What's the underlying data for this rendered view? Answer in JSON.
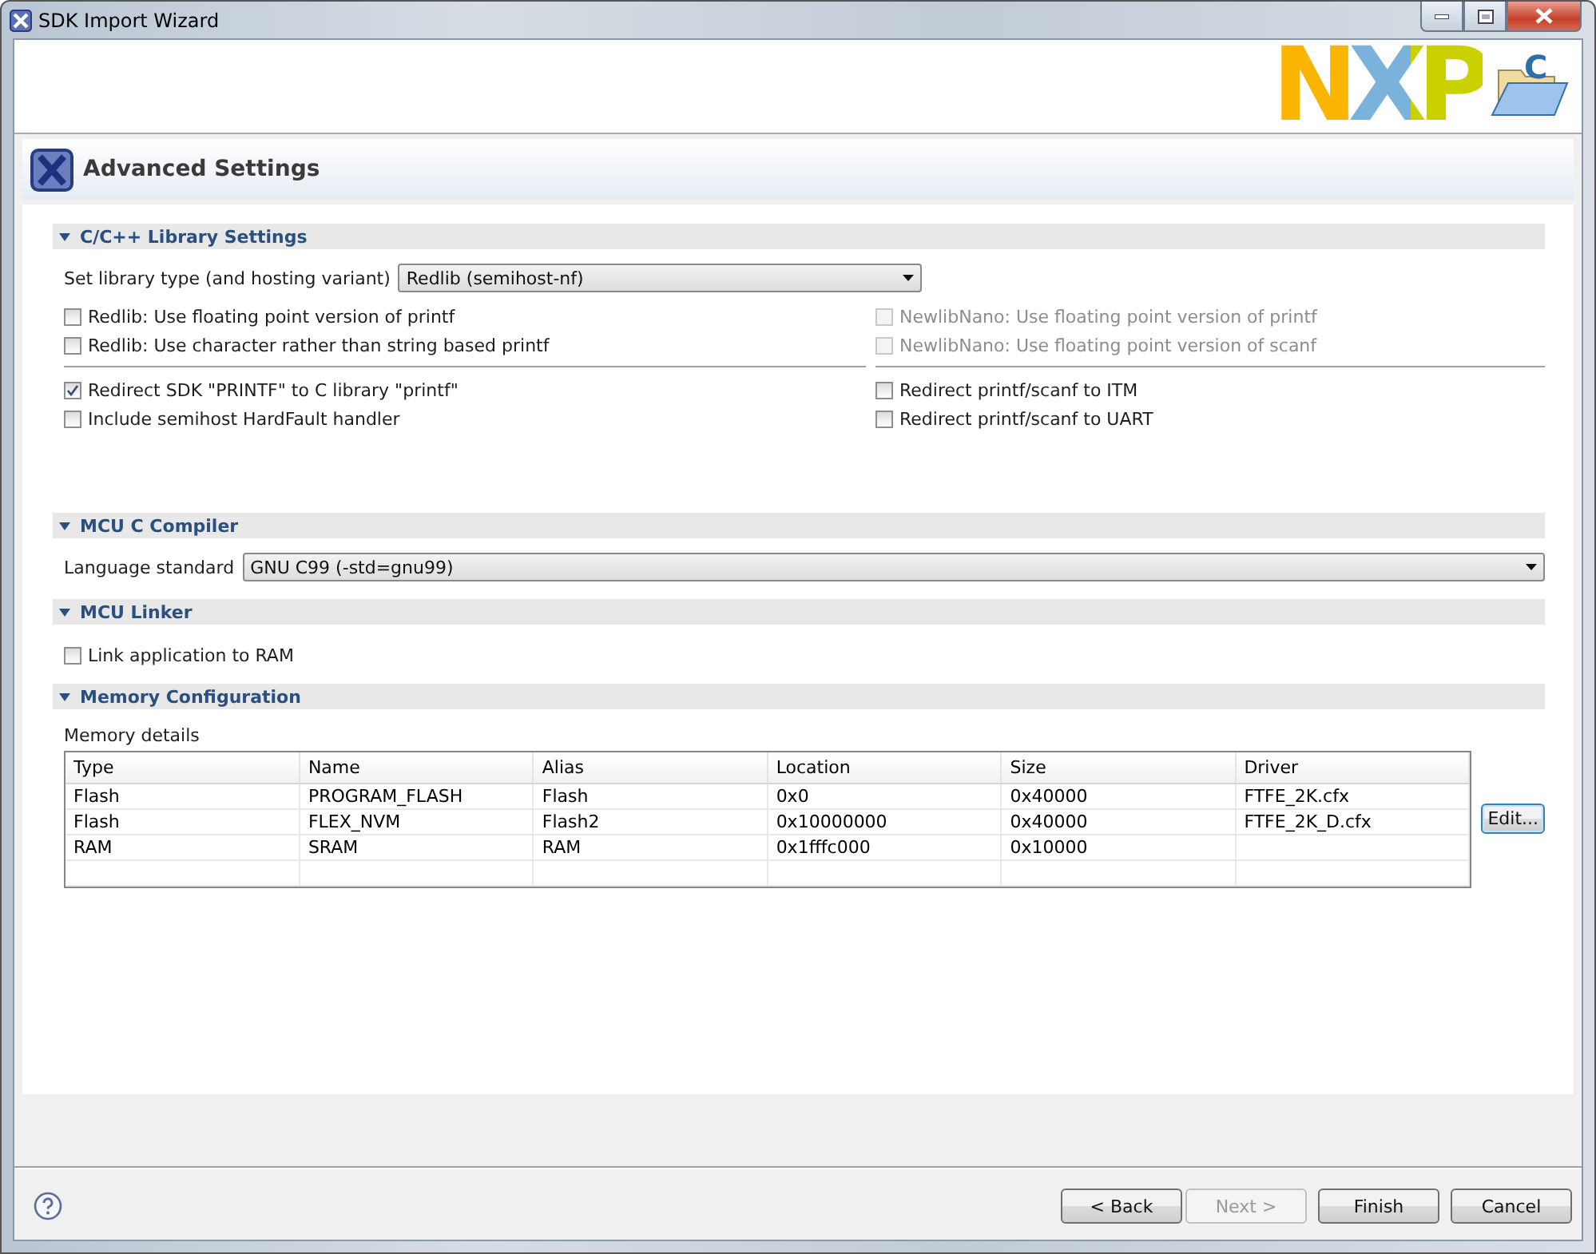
{
  "window": {
    "title": "SDK Import Wizard"
  },
  "header": {
    "logo": "NXP",
    "folder_icon_letter": "C"
  },
  "page": {
    "title": "Advanced Settings"
  },
  "sections": [
    {
      "title": "C/C++ Library Settings",
      "expanded": true,
      "items": [
        {
          "kind": "select",
          "label": "Set library type (and hosting variant)",
          "value": "Redlib (semihost-nf)",
          "wide": false
        },
        {
          "kind": "checkgrid",
          "left": [
            [
              {
                "label": "Redlib: Use floating point version of printf",
                "checked": false,
                "disabled": false
              },
              {
                "label": "Redlib: Use character rather than string based printf",
                "checked": false,
                "disabled": false
              }
            ],
            [
              {
                "label": "Redirect SDK \"PRINTF\" to C library \"printf\"",
                "checked": true,
                "disabled": false
              },
              {
                "label": "Include semihost HardFault handler",
                "checked": false,
                "disabled": false
              }
            ]
          ],
          "right": [
            [
              {
                "label": "NewlibNano: Use floating point version of printf",
                "checked": false,
                "disabled": true
              },
              {
                "label": "NewlibNano: Use floating point version of scanf",
                "checked": false,
                "disabled": true
              }
            ],
            [
              {
                "label": "Redirect printf/scanf to ITM",
                "checked": false,
                "disabled": false
              },
              {
                "label": "Redirect printf/scanf to UART",
                "checked": false,
                "disabled": false
              }
            ]
          ]
        }
      ]
    },
    {
      "title": "MCU C Compiler",
      "expanded": true,
      "items": [
        {
          "kind": "select",
          "label": "Language standard",
          "value": "GNU C99 (-std=gnu99)",
          "wide": true
        }
      ]
    },
    {
      "title": "MCU Linker",
      "expanded": true,
      "items": [
        {
          "kind": "checkbox",
          "label": "Link application to RAM",
          "checked": false,
          "disabled": false
        }
      ]
    },
    {
      "title": "Memory Configuration",
      "expanded": true,
      "items": [
        {
          "kind": "table",
          "label": "Memory details",
          "columns": [
            "Type",
            "Name",
            "Alias",
            "Location",
            "Size",
            "Driver"
          ],
          "rows": [
            [
              "Flash",
              "PROGRAM_FLASH",
              "Flash",
              "0x0",
              "0x40000",
              "FTFE_2K.cfx"
            ],
            [
              "Flash",
              "FLEX_NVM",
              "Flash2",
              "0x10000000",
              "0x40000",
              "FTFE_2K_D.cfx"
            ],
            [
              "RAM",
              "SRAM",
              "RAM",
              "0x1fffc000",
              "0x10000",
              ""
            ]
          ],
          "button": "Edit..."
        }
      ]
    }
  ],
  "footer": {
    "buttons": [
      {
        "label": "< Back",
        "disabled": false,
        "kind": "normal"
      },
      {
        "label": "Next >",
        "disabled": true,
        "kind": "normal"
      },
      {
        "label": "Finish",
        "disabled": false,
        "kind": "gap"
      },
      {
        "label": "Cancel",
        "disabled": false,
        "kind": "gap"
      }
    ]
  }
}
